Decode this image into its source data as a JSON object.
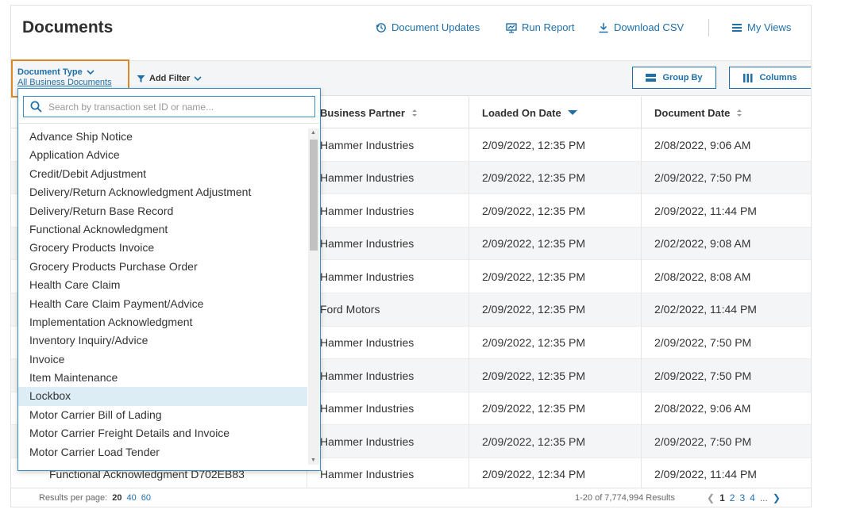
{
  "header": {
    "title": "Documents",
    "document_updates": "Document Updates",
    "run_report": "Run Report",
    "download_csv": "Download CSV",
    "my_views": "My Views"
  },
  "filters": {
    "doc_type_label": "Document Type",
    "doc_type_value": "All Business Documents",
    "add_filter": "Add Filter",
    "group_by": "Group By",
    "columns": "Columns"
  },
  "table": {
    "columns": [
      "",
      "Business Partner",
      "Loaded On Date",
      "Document Date"
    ],
    "rows": [
      [
        "",
        "Hammer Industries",
        "2/09/2022, 12:35 PM",
        "2/08/2022, 9:06 AM"
      ],
      [
        "",
        "Hammer Industries",
        "2/09/2022, 12:35 PM",
        "2/09/2022, 7:50 PM"
      ],
      [
        "",
        "Hammer Industries",
        "2/09/2022, 12:35 PM",
        "2/09/2022, 11:44 PM"
      ],
      [
        "",
        "Hammer Industries",
        "2/09/2022, 12:35 PM",
        "2/02/2022, 9:08 AM"
      ],
      [
        "",
        "Hammer Industries",
        "2/09/2022, 12:35 PM",
        "2/08/2022, 8:08 AM"
      ],
      [
        "",
        "Ford Motors",
        "2/09/2022, 12:35 PM",
        "2/02/2022, 11:44 PM"
      ],
      [
        "",
        "Hammer Industries",
        "2/09/2022, 12:35 PM",
        "2/09/2022, 7:50 PM"
      ],
      [
        "",
        "Hammer Industries",
        "2/09/2022, 12:35 PM",
        "2/09/2022, 7:50 PM"
      ],
      [
        "",
        "Hammer Industries",
        "2/09/2022, 12:35 PM",
        "2/08/2022, 9:06 AM"
      ],
      [
        "",
        "Hammer Industries",
        "2/09/2022, 12:35 PM",
        "2/09/2022, 7:50 PM"
      ],
      [
        "Functional Acknowledgment D702EB83",
        "Hammer Industries",
        "2/09/2022, 12:34 PM",
        "2/09/2022, 11:44 PM"
      ]
    ]
  },
  "footer": {
    "results_per_page_label": "Results per page:",
    "per_page_options": [
      "20",
      "40",
      "60"
    ],
    "results_text": "1-20 of 7,774,994 Results",
    "pages": [
      "1",
      "2",
      "3",
      "4"
    ],
    "ellipsis": "..."
  },
  "dropdown": {
    "search_placeholder": "Search by transaction set ID or name...",
    "items": [
      "Advance Ship Notice",
      "Application Advice",
      "Credit/Debit Adjustment",
      "Delivery/Return Acknowledgment Adjustment",
      "Delivery/Return Base Record",
      "Functional Acknowledgment",
      "Grocery Products Invoice",
      "Grocery Products Purchase Order",
      "Health Care Claim",
      "Health Care Claim Payment/Advice",
      "Implementation Acknowledgment",
      "Inventory Inquiry/Advice",
      "Invoice",
      "Item Maintenance",
      "Lockbox",
      "Motor Carrier Bill of Lading",
      "Motor Carrier Freight Details and Invoice",
      "Motor Carrier Load Tender"
    ],
    "highlighted": "Lockbox"
  },
  "colors": {
    "accent": "#1f6fa8",
    "focus": "#3a8fc4",
    "highlight": "#dcedf6",
    "selected_border": "#d9892a"
  }
}
